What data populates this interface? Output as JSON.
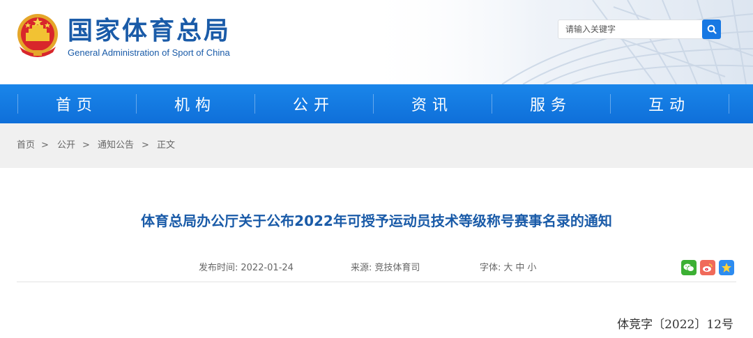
{
  "header": {
    "site_title": "国家体育总局",
    "site_subtitle": "General Administration of Sport of China",
    "search_placeholder": "请输入关键字",
    "logo_icon": "national-emblem-icon",
    "search_icon": "magnifier-icon"
  },
  "nav": {
    "items": [
      {
        "label": "首页"
      },
      {
        "label": "机构"
      },
      {
        "label": "公开"
      },
      {
        "label": "资讯"
      },
      {
        "label": "服务"
      },
      {
        "label": "互动"
      }
    ],
    "color": "#1478e0"
  },
  "breadcrumb": {
    "items": [
      "首页",
      "公开",
      "通知公告",
      "正文"
    ],
    "separator": ">"
  },
  "article": {
    "title": "体育总局办公厅关于公布2022年可授予运动员技术等级称号赛事名录的通知",
    "publish_label": "发布时间:",
    "publish_date": "2022-01-24",
    "source_label": "来源:",
    "source_value": "竞技体育司",
    "font_label": "字体:",
    "font_large": "大",
    "font_medium": "中",
    "font_small": "小",
    "doc_number": "体竞字〔2022〕12号"
  },
  "share": {
    "icons": [
      "wechat-icon",
      "weibo-icon",
      "qzone-icon"
    ],
    "colors": {
      "wechat": "#3cb034",
      "weibo": "#e6162d",
      "qzone": "#2d8cf0"
    }
  },
  "colors": {
    "brand_blue": "#1a5ba8",
    "nav_blue": "#1478e0",
    "crumb_bg": "#f0f0f0"
  }
}
